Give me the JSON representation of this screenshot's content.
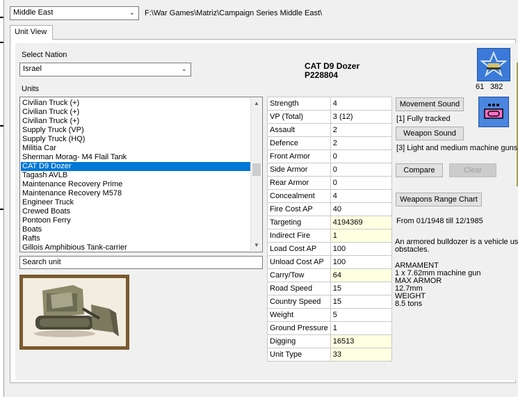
{
  "campaign": {
    "selected": "Middle East",
    "path": "F:\\War Games\\Matriz\\Campaign Series Middle East\\"
  },
  "tabs": [
    {
      "label": "Unit View"
    }
  ],
  "nation": {
    "label": "Select Nation",
    "selected": "Israel"
  },
  "units": {
    "label": "Units",
    "items": [
      "Civilian Truck (+)",
      "Civilian Truck (+)",
      "Civilian Truck (+)",
      "Supply Truck (VP)",
      "Supply Truck (HQ)",
      "Militia Car",
      "Sherman Morag- M4 Flail Tank",
      "CAT D9 Dozer",
      "Tagash AVLB",
      "Maintenance Recovery Prime",
      "Maintenance Recovery M578",
      "Engineer Truck",
      "Crewed Boats",
      "Pontoon Ferry",
      "Boats",
      "Rafts",
      "Gillois Amphibious Tank-carrier"
    ],
    "selected_index": 7
  },
  "search": {
    "value": "Search unit"
  },
  "unit": {
    "name": "CAT D9 Dozer",
    "code": "P228804"
  },
  "stats": [
    {
      "label": "Strength",
      "value": "4",
      "highlight": false
    },
    {
      "label": "VP (Total)",
      "value": "3 (12)",
      "highlight": false
    },
    {
      "label": "Assault",
      "value": "2",
      "highlight": false
    },
    {
      "label": "Defence",
      "value": "2",
      "highlight": false
    },
    {
      "label": "Front Armor",
      "value": "0",
      "highlight": false
    },
    {
      "label": "Side Armor",
      "value": "0",
      "highlight": false
    },
    {
      "label": "Rear Armor",
      "value": "0",
      "highlight": false
    },
    {
      "label": "Concealment",
      "value": "4",
      "highlight": false
    },
    {
      "label": "Fire Cost AP",
      "value": "40",
      "highlight": false
    },
    {
      "label": "Targeting",
      "value": "4194369",
      "highlight": true
    },
    {
      "label": "Indirect Fire",
      "value": "1",
      "highlight": true
    },
    {
      "label": "Load Cost AP",
      "value": "100",
      "highlight": false
    },
    {
      "label": "Unload Cost AP",
      "value": "100",
      "highlight": false
    },
    {
      "label": "Carry/Tow",
      "value": "64",
      "highlight": true
    },
    {
      "label": "Road Speed",
      "value": "15",
      "highlight": false
    },
    {
      "label": "Country Speed",
      "value": "15",
      "highlight": false
    },
    {
      "label": "Weight",
      "value": "5",
      "highlight": false
    },
    {
      "label": "Ground Pressure",
      "value": "1",
      "highlight": false
    },
    {
      "label": "Digging",
      "value": "16513",
      "highlight": true
    },
    {
      "label": "Unit Type",
      "value": "33",
      "highlight": true
    }
  ],
  "counter": {
    "left": "61",
    "right": "382"
  },
  "buttons": {
    "movement_sound": "Movement Sound",
    "weapon_sound": "Weapon Sound",
    "compare": "Compare",
    "clear": "Clear",
    "weapons_range_chart": "Weapons Range Chart"
  },
  "movement_desc": "[1] Fully tracked",
  "weapon_desc": "[3] Light and medium machine guns",
  "date_range": "From 01/1948 till 12/1985",
  "description": {
    "line1": "An armored bulldozer is a vehicle used",
    "line2": "obstacles.",
    "armament_label": "ARMAMENT",
    "armament": "1 x 7.62mm machine gun",
    "armor_label": "MAX ARMOR",
    "armor": "12.7mm",
    "weight_label": "WEIGHT",
    "weight": "8.5 tons"
  },
  "colors": {
    "selection": "#0078d7",
    "highlight_cell": "#ffffe1",
    "icon_blue": "#3b7ad9",
    "frame_brown": "#7a5a2f"
  }
}
